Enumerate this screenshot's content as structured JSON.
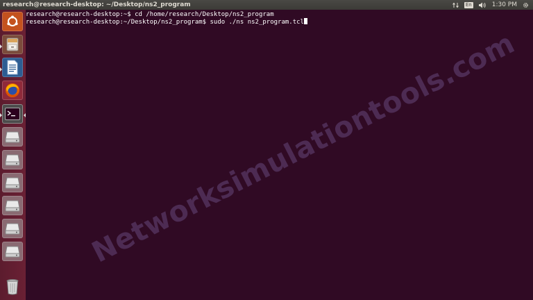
{
  "top_panel": {
    "window_title": "research@research-desktop: ~/Desktop/ns2_program",
    "keyboard_layout": "En",
    "clock": "1:30 PM",
    "icons": [
      "network-arrows-icon",
      "keyboard-layout-icon",
      "volume-icon",
      "power-gear-icon"
    ]
  },
  "launcher": {
    "items": [
      {
        "name": "ubuntu-dash",
        "icon": "ubuntu-logo-icon"
      },
      {
        "name": "files",
        "icon": "file-cabinet-icon"
      },
      {
        "name": "libreoffice-writer",
        "icon": "document-icon"
      },
      {
        "name": "firefox",
        "icon": "firefox-icon"
      },
      {
        "name": "terminal",
        "icon": "terminal-icon"
      },
      {
        "name": "drive-1",
        "icon": "drive-icon"
      },
      {
        "name": "drive-2",
        "icon": "drive-icon"
      },
      {
        "name": "drive-3",
        "icon": "drive-icon"
      },
      {
        "name": "drive-4",
        "icon": "drive-icon"
      },
      {
        "name": "drive-5",
        "icon": "drive-icon"
      },
      {
        "name": "drive-6",
        "icon": "drive-icon"
      },
      {
        "name": "trash",
        "icon": "trash-icon"
      }
    ]
  },
  "terminal": {
    "lines": [
      "research@research-desktop:~$ cd /home/research/Desktop/ns2_program",
      "research@research-desktop:~/Desktop/ns2_program$ sudo ./ns ns2_program.tcl"
    ]
  },
  "watermark": "Networksimulationtools.com",
  "colors": {
    "terminal_bg": "#300a24",
    "launcher_bg": "#5c1c2e",
    "panel_bg": "#3c3b37",
    "firefox_orange": "#e66000",
    "dash_orange": "#e95420"
  }
}
